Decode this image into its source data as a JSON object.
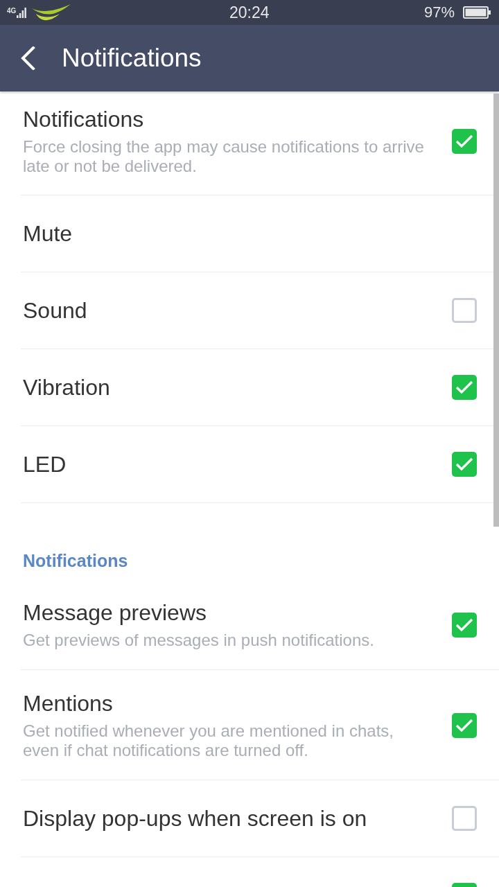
{
  "status_bar": {
    "network": "4G",
    "time": "20:24",
    "battery": "97%"
  },
  "header": {
    "title": "Notifications"
  },
  "sections": [
    {
      "items": [
        {
          "kind": "checkbox",
          "title": "Notifications",
          "description": "Force closing the app may cause notifications to arrive late or not be delivered.",
          "checked": true
        },
        {
          "kind": "link",
          "title": "Mute"
        },
        {
          "kind": "checkbox",
          "title": "Sound",
          "checked": false
        },
        {
          "kind": "checkbox",
          "title": "Vibration",
          "checked": true
        },
        {
          "kind": "checkbox",
          "title": "LED",
          "checked": true
        }
      ]
    },
    {
      "title": "Notifications",
      "items": [
        {
          "kind": "checkbox",
          "title": "Message previews",
          "description": "Get previews of messages in push notifications.",
          "checked": true
        },
        {
          "kind": "checkbox",
          "title": "Mentions",
          "description": "Get notified whenever you are mentioned in chats, even if chat notifications are turned off.",
          "checked": true
        },
        {
          "kind": "checkbox",
          "title": "Display pop-ups when screen is on",
          "checked": false
        },
        {
          "kind": "checkbox",
          "checked": true
        }
      ]
    }
  ]
}
